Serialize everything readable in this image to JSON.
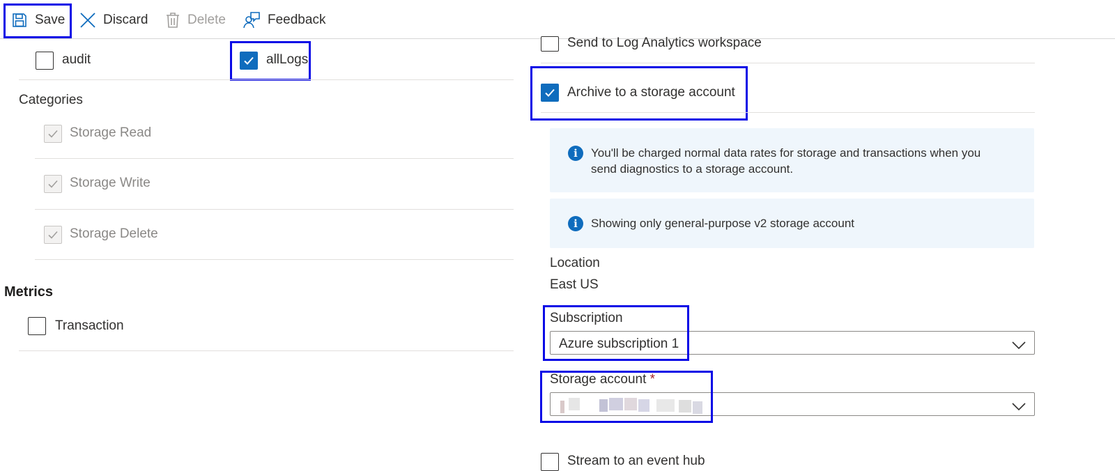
{
  "toolbar": {
    "save_label": "Save",
    "discard_label": "Discard",
    "delete_label": "Delete",
    "feedback_label": "Feedback"
  },
  "logs": {
    "category_groups": [
      {
        "label": "audit",
        "checked": false
      },
      {
        "label": "allLogs",
        "checked": true
      }
    ],
    "categories_heading": "Categories",
    "categories": [
      {
        "label": "Storage Read",
        "checked": true,
        "disabled": true
      },
      {
        "label": "Storage Write",
        "checked": true,
        "disabled": true
      },
      {
        "label": "Storage Delete",
        "checked": true,
        "disabled": true
      }
    ]
  },
  "metrics": {
    "heading": "Metrics",
    "items": [
      {
        "label": "Transaction",
        "checked": false
      }
    ]
  },
  "destination": {
    "log_analytics_label": "Send to Log Analytics workspace",
    "log_analytics_checked": false,
    "archive_label": "Archive to a storage account",
    "archive_checked": true,
    "info_charge_line1": "You'll be charged normal data rates for storage and transactions when you",
    "info_charge_line2": "send diagnostics to a storage account.",
    "info_v2": "Showing only general-purpose v2 storage account",
    "location_label": "Location",
    "location_value": "East US",
    "subscription_label": "Subscription",
    "subscription_value": "Azure subscription 1",
    "storage_account_label": "Storage account",
    "required_marker": "*",
    "event_hub_label": "Stream to an event hub"
  },
  "colors": {
    "accent": "#0f6cbd",
    "highlight_box": "#0a0ae6",
    "info_bg": "#eff6fc",
    "required": "#a4262c"
  }
}
